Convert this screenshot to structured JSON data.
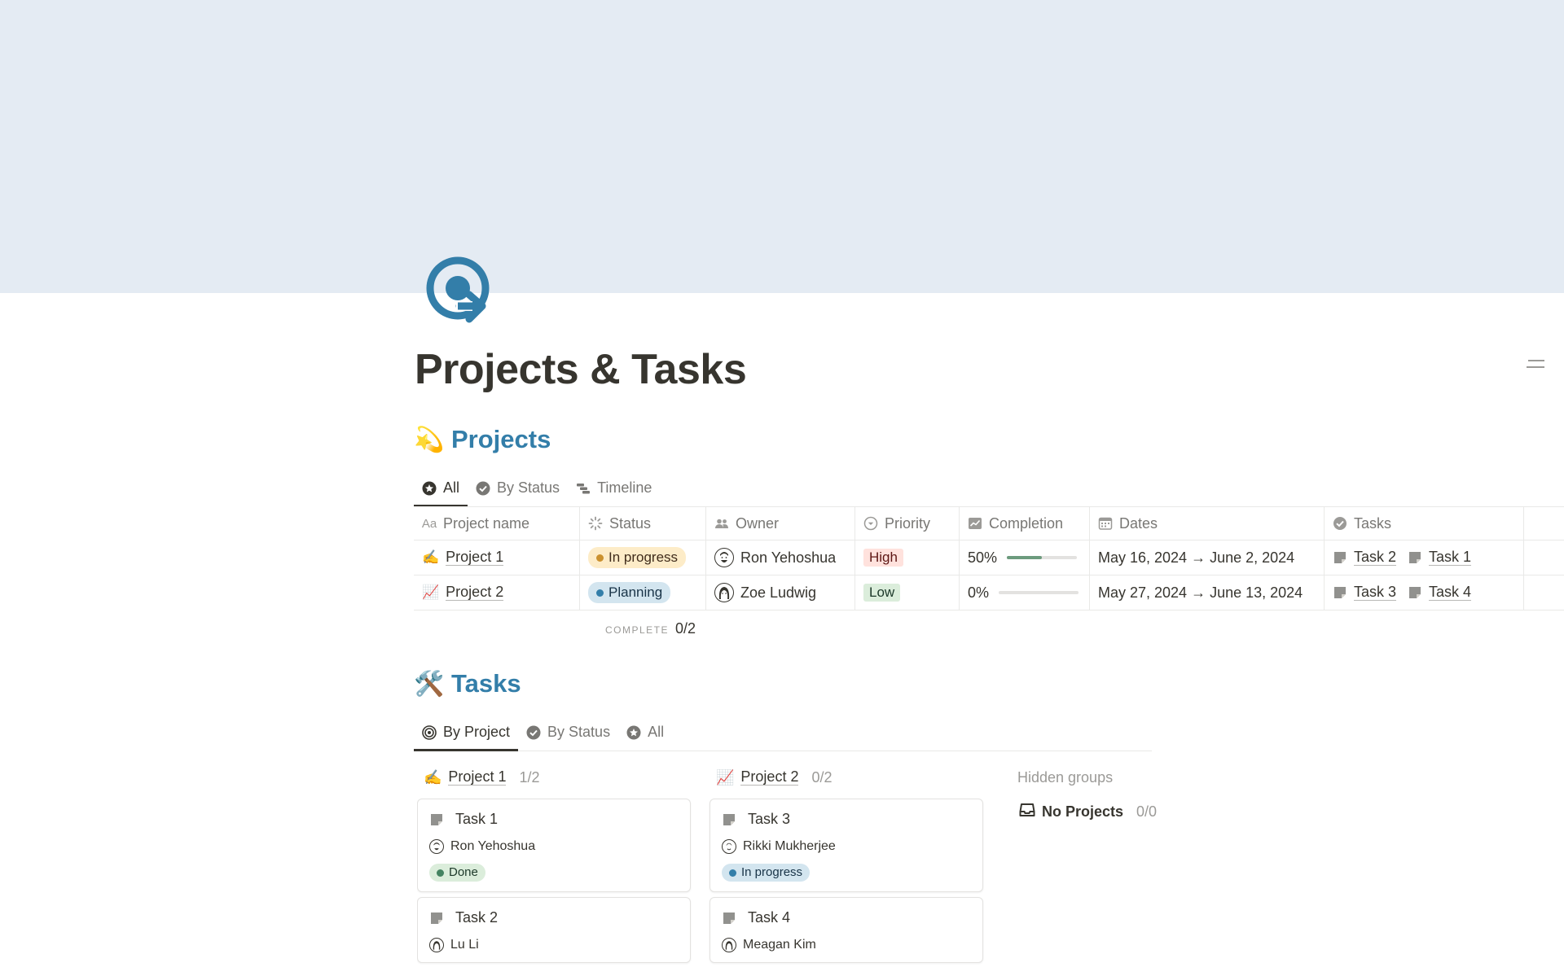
{
  "page": {
    "title": "Projects & Tasks",
    "icon": "target-arrow-icon",
    "cover_color": "#e4ebf3",
    "accent": "#337ea9"
  },
  "projects": {
    "emoji": "💫",
    "heading": "Projects",
    "tabs": [
      {
        "label": "All",
        "icon": "star-icon",
        "active": true
      },
      {
        "label": "By Status",
        "icon": "check-circle-icon",
        "active": false
      },
      {
        "label": "Timeline",
        "icon": "timeline-icon",
        "active": false
      }
    ],
    "columns": [
      "Project name",
      "Status",
      "Owner",
      "Priority",
      "Completion",
      "Dates",
      "Tasks"
    ],
    "rows": [
      {
        "emoji": "✍️",
        "name": "Project 1",
        "status": "In progress",
        "owner": "Ron Yehoshua",
        "priority": "High",
        "completion": "50%",
        "completion_value": 0.5,
        "dates": "May 16, 2024 → June 2, 2024",
        "tasks": [
          "Task 2",
          "Task 1"
        ]
      },
      {
        "emoji": "📈",
        "name": "Project 2",
        "status": "Planning",
        "owner": "Zoe Ludwig",
        "priority": "Low",
        "completion": "0%",
        "completion_value": 0,
        "dates": "May 27, 2024 → June 13, 2024",
        "tasks": [
          "Task 3",
          "Task 4"
        ]
      }
    ],
    "calc_label": "COMPLETE",
    "calc_value": "0/2"
  },
  "tasks": {
    "emoji": "🛠️",
    "heading": "Tasks",
    "tabs": [
      {
        "label": "By Project",
        "icon": "target-icon",
        "active": true
      },
      {
        "label": "By Status",
        "icon": "check-circle-icon",
        "active": false
      },
      {
        "label": "All",
        "icon": "star-icon",
        "active": false
      }
    ],
    "groups": [
      {
        "emoji": "✍️",
        "name": "Project 1",
        "count": "1/2",
        "cards": [
          {
            "title": "Task 1",
            "person": "Ron Yehoshua",
            "status": "Done"
          },
          {
            "title": "Task 2",
            "person": "Lu Li",
            "status": ""
          }
        ]
      },
      {
        "emoji": "📈",
        "name": "Project 2",
        "count": "0/2",
        "cards": [
          {
            "title": "Task 3",
            "person": "Rikki Mukherjee",
            "status": "In progress"
          },
          {
            "title": "Task 4",
            "person": "Meagan Kim",
            "status": ""
          }
        ]
      }
    ],
    "hidden_groups_label": "Hidden groups",
    "no_projects": {
      "label": "No Projects",
      "count": "0/0",
      "icon": "inbox-icon"
    }
  }
}
